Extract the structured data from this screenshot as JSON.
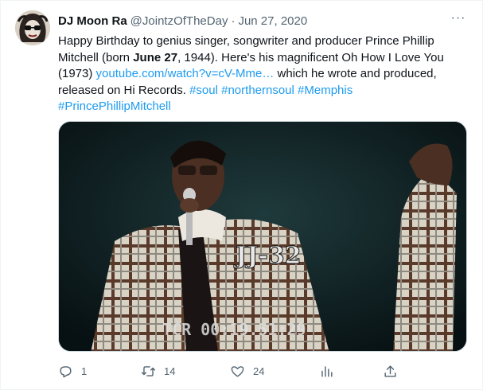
{
  "author": {
    "name": "DJ Moon Ra",
    "handle": "@JointzOfTheDay",
    "separator": "·",
    "date": "Jun 27, 2020"
  },
  "more_label": "···",
  "tweet": {
    "p1": "Happy Birthday to genius singer, songwriter and producer Prince Phillip Mitchell (born ",
    "bold": "June 27",
    "p2": ", 1944). Here's his magnificent Oh How I Love You (1973) ",
    "link": "youtube.com/watch?v=cV-Mme…",
    "p3": " which he wrote and produced, released on Hi Records. ",
    "hashtags": [
      "#soul",
      "#northernsoul",
      "#Memphis",
      "#PrincePhillipMitchell"
    ]
  },
  "media": {
    "overlay_text": "JJ-32",
    "timecode": "TCR 00:19.51:29"
  },
  "actions": {
    "replies": "1",
    "retweets": "14",
    "likes": "24"
  },
  "colors": {
    "link": "#1d9bf0",
    "muted": "#536471"
  }
}
